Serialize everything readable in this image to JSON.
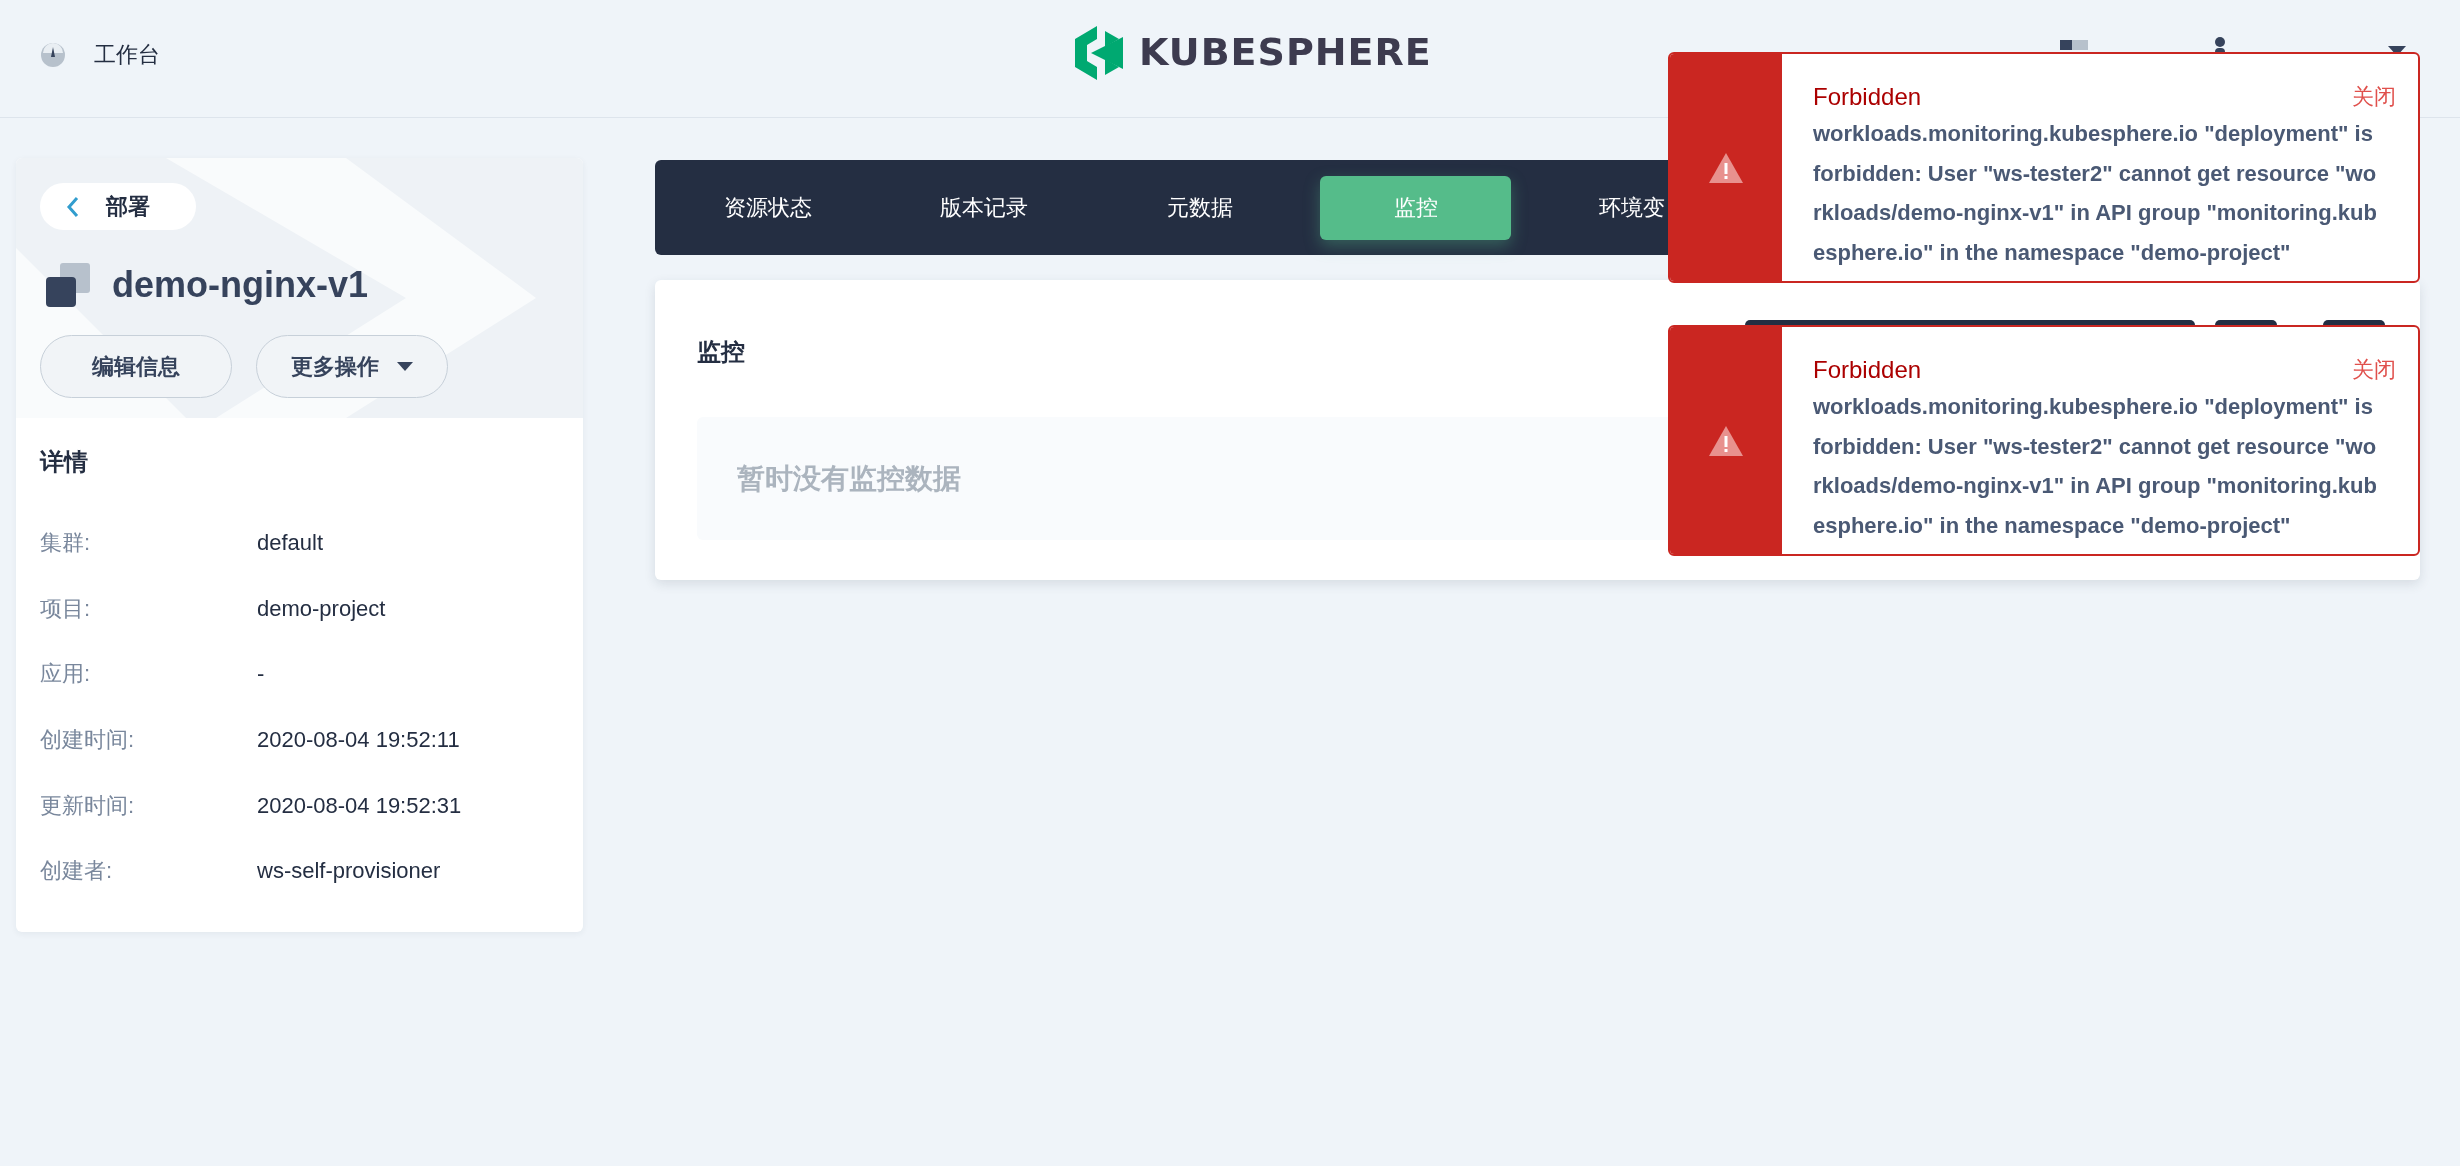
{
  "header": {
    "workbench": "工作台",
    "logo": "KUBESPHERE"
  },
  "sidebar": {
    "back": "部署",
    "title": "demo-nginx-v1",
    "buttons": [
      {
        "label": "编辑信息",
        "kind": "plain"
      },
      {
        "label": "更多操作",
        "kind": "dropdown"
      }
    ],
    "details_title": "详情",
    "details": [
      {
        "label": "集群:",
        "value": "default"
      },
      {
        "label": "项目:",
        "value": "demo-project"
      },
      {
        "label": "应用:",
        "value": "-"
      },
      {
        "label": "创建时间:",
        "value": "2020-08-04 19:52:11"
      },
      {
        "label": "更新时间:",
        "value": "2020-08-04 19:52:31"
      },
      {
        "label": "创建者:",
        "value": "ws-self-provisioner"
      }
    ]
  },
  "tabs": [
    {
      "label": "资源状态",
      "selected": false
    },
    {
      "label": "版本记录",
      "selected": false
    },
    {
      "label": "元数据",
      "selected": false
    },
    {
      "label": "监控",
      "selected": true
    },
    {
      "label": "环境变",
      "selected": false
    }
  ],
  "panel": {
    "title": "监控",
    "empty": "暂时没有监控数据"
  },
  "notifications": [
    {
      "title": "Forbidden",
      "close": "关闭",
      "message": "workloads.monitoring.kubesphere.io \"deployment\" is forbidden: User \"ws-tester2\" cannot get resource \"workloads/demo-nginx-v1\" in API group \"monitoring.kubesphere.io\" in the namespace \"demo-project\""
    },
    {
      "title": "Forbidden",
      "close": "关闭",
      "message": "workloads.monitoring.kubesphere.io \"deployment\" is forbidden: User \"ws-tester2\" cannot get resource \"workloads/demo-nginx-v1\" in API group \"monitoring.kubesphere.io\" in the namespace \"demo-project\""
    }
  ]
}
